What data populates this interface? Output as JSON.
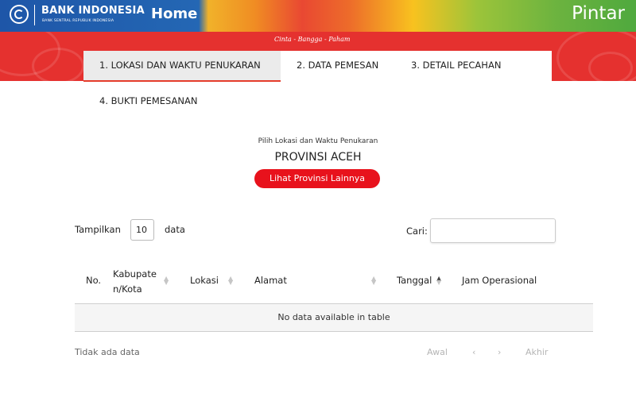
{
  "header": {
    "logo_main": "BANK INDONESIA",
    "logo_sub": "BANK SENTRAL REPUBLIK INDONESIA",
    "home_label": "Home",
    "brand": "Pintar",
    "colors": {
      "blue": "#1e56a8",
      "green": "#4fa93e",
      "red": "#e5312f"
    }
  },
  "banner": {
    "tagline": "Cinta - Bangga - Paham"
  },
  "steps": [
    {
      "label": "1. LOKASI DAN WAKTU PENUKARAN",
      "active": true
    },
    {
      "label": "2. DATA PEMESAN",
      "active": false
    },
    {
      "label": "3. DETAIL PECAHAN",
      "active": false
    },
    {
      "label": "4. BUKTI PEMESANAN",
      "active": false
    }
  ],
  "selection": {
    "choose_label": "Pilih Lokasi dan Waktu Penukaran",
    "province": "PROVINSI ACEH",
    "other_province_button": "Lihat Provinsi Lainnya"
  },
  "table_controls": {
    "show_label": "Tampilkan",
    "page_size": "10",
    "data_label": "data",
    "search_label": "Cari:",
    "search_value": ""
  },
  "table": {
    "columns": [
      "No.",
      "Kabupate n/Kota",
      "Lokasi",
      "Alamat",
      "Tanggal",
      "Jam Operasional"
    ],
    "empty_message": "No data available in table",
    "info": "Tidak ada data"
  },
  "pagination": {
    "first": "Awal",
    "prev": "‹",
    "next": "›",
    "last": "Akhir"
  }
}
